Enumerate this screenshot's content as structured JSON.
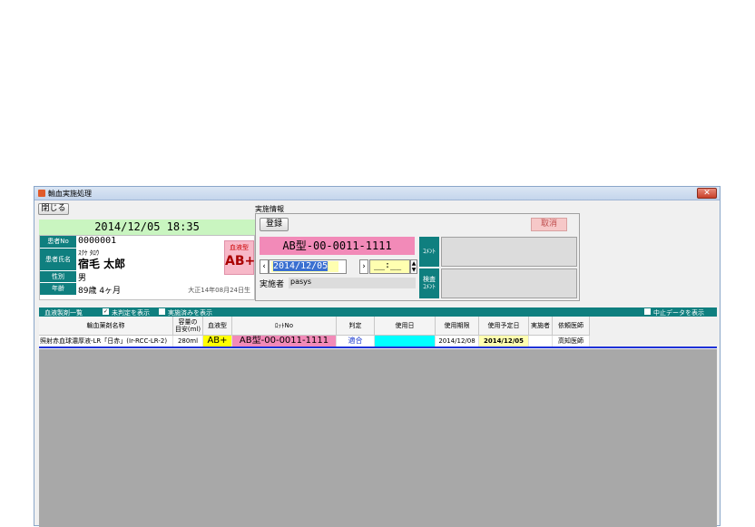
{
  "window": {
    "title": "輸血実施処理",
    "close_label": "✕"
  },
  "toolbar": {
    "close_button_label": "閉じる"
  },
  "patient": {
    "datetime": "2014/12/05 18:35",
    "labels": {
      "id": "患者No",
      "name": "患者氏名",
      "sex": "性別",
      "age": "年齢"
    },
    "id": "0000001",
    "kana": "ｽｸｹ ﾀﾛｳ",
    "name": "宿毛 太郎",
    "sex": "男",
    "age": "89歳 4ヶ月",
    "birth": "大正14年08月24日生",
    "blood_type_label": "血液型",
    "blood_type": "AB+"
  },
  "execution": {
    "section_title": "実施情報",
    "register_label": "登録",
    "cancel_label": "取消",
    "lot_no": "AB型-00-0011-1111",
    "date": "2014/12/05",
    "time": "__:__",
    "performer_label": "実施者",
    "performer": "pasys",
    "comment_label": "ｺﾒﾝﾄ",
    "test_comment_label": "検査\nｺﾒﾝﾄ"
  },
  "list": {
    "title": "血液製剤一覧",
    "show_undetermined": "未判定を表示",
    "show_done": "実施済みを表示",
    "show_cancelled": "中止データを表示",
    "columns": [
      "輸血薬剤名称",
      "容量の\n目安(ml)",
      "血液型",
      "ﾛｯﾄNo",
      "判定",
      "使用日",
      "使用期限",
      "使用予定日",
      "実施者",
      "依頼医師"
    ],
    "rows": [
      {
        "name": "照射赤血球濃厚液-LR「日赤」(Ir-RCC-LR-2)",
        "volume": "280ml",
        "blood_type": "AB+",
        "lot": "AB型-00-0011-1111",
        "judgement": "適合",
        "use_date": "",
        "expiry": "2014/12/08",
        "planned": "2014/12/05",
        "performer": "",
        "doctor": "高知医師"
      }
    ]
  },
  "colors": {
    "teal": "#0f7f7f",
    "green_header": "#c9f5c0",
    "pink": "#f28ab8",
    "yellow": "#ffff00",
    "cyan": "#00ffff"
  }
}
